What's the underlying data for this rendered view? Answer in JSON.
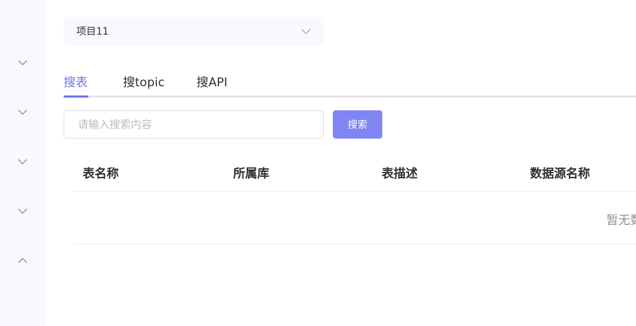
{
  "sidebar": {
    "menus": [
      {
        "icon": "chevron-down-icon"
      },
      {
        "icon": "chevron-down-icon"
      },
      {
        "icon": "chevron-down-icon"
      },
      {
        "icon": "chevron-down-icon"
      },
      {
        "icon": "chevron-up-icon"
      }
    ]
  },
  "project_select": {
    "value": "项目11",
    "icon": "chevron-down-icon"
  },
  "tabs": [
    {
      "label": "搜表",
      "active": true
    },
    {
      "label": "搜topic",
      "active": false
    },
    {
      "label": "搜API",
      "active": false
    }
  ],
  "search": {
    "placeholder": "请输入搜索内容",
    "value": "",
    "button_label": "搜索"
  },
  "table": {
    "columns": [
      "表名称",
      "所属库",
      "表描述",
      "数据源名称"
    ],
    "rows": [],
    "empty_text": "暂无数据"
  },
  "colors": {
    "accent": "#6f78e6",
    "button": "#7f86f4",
    "sidebar_bg": "#f9f8fd"
  }
}
